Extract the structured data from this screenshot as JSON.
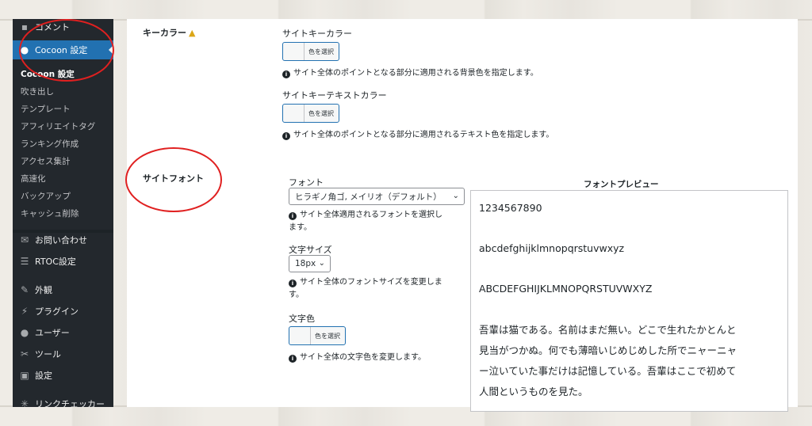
{
  "sidebar": {
    "top_partial": "コメント",
    "active": "Cocoon 設定",
    "sub_items": [
      "Cocoon 設定",
      "吹き出し",
      "テンプレート",
      "アフィリエイトタグ",
      "ランキング作成",
      "アクセス集計",
      "高速化",
      "バックアップ",
      "キャッシュ削除"
    ],
    "items": [
      {
        "label": "お問い合わせ",
        "icon": "mail-icon"
      },
      {
        "label": "RTOC設定",
        "icon": "list-icon"
      },
      {
        "label": "外観",
        "icon": "paintbrush-icon"
      },
      {
        "label": "プラグイン",
        "icon": "plugin-icon"
      },
      {
        "label": "ユーザー",
        "icon": "user-icon"
      },
      {
        "label": "ツール",
        "icon": "wrench-icon"
      },
      {
        "label": "設定",
        "icon": "settings-icon"
      },
      {
        "label": "リンクチェッカー",
        "icon": "link-checker-icon"
      }
    ]
  },
  "key_color": {
    "title": "キーカラー",
    "warn_icon": "warning-icon",
    "site_key_color_label": "サイトキーカラー",
    "site_key_color_button": "色を選択",
    "site_key_color_desc": "サイト全体のポイントとなる部分に適用される背景色を指定します。",
    "site_key_text_color_label": "サイトキーテキストカラー",
    "site_key_text_color_button": "色を選択",
    "site_key_text_color_desc": "サイト全体のポイントとなる部分に適用されるテキスト色を指定します。"
  },
  "site_font": {
    "title": "サイトフォント",
    "font_label": "フォント",
    "font_value": "ヒラギノ角ゴ, メイリオ（デフォルト）",
    "font_desc_1": "サイト全体適用されるフォントを選択し",
    "font_desc_2": "ます。",
    "size_label": "文字サイズ",
    "size_value": "18px",
    "size_desc_1": "サイト全体のフォントサイズを変更しま",
    "size_desc_2": "す。",
    "color_label": "文字色",
    "color_button": "色を選択",
    "color_desc": "サイト全体の文字色を変更します。"
  },
  "preview": {
    "title": "フォントプレビュー",
    "numbers": "1234567890",
    "lower": "abcdefghijklmnopqrstuvwxyz",
    "upper": "ABCDEFGHIJKLMNOPQRSTUVWXYZ",
    "paragraph_lines": [
      "吾輩は猫である。名前はまだ無い。どこで生れたかとんと",
      "見当がつかぬ。何でも薄暗いじめじめした所でニャーニャ",
      "ー泣いていた事だけは記憶している。吾輩はここで初めて",
      "人間というものを見た。"
    ]
  },
  "colors": {
    "accent": "#2271b1",
    "sidebar": "#23282d",
    "annotation": "#e02020"
  }
}
